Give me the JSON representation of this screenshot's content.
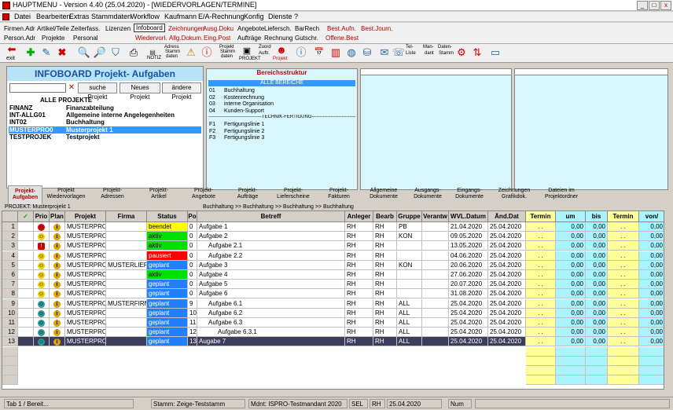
{
  "window": {
    "title": "HAUPTMENU - Version 4.40 (25.04.2020) - [WIEDERVORLAGEN/TERMINE]",
    "min": "_",
    "max": "□",
    "close": "x"
  },
  "menu": [
    "Datei",
    "Bearbeiten",
    "Extras",
    "Stammdaten",
    "Workflow",
    "Kaufmann",
    "E/A-Rechnung",
    "Konfig",
    "Dienste",
    "?"
  ],
  "quick_top": [
    "Firmen.Adr",
    "Artikel/Teile",
    "Zeiterfass.",
    "Lizenzen",
    "Infoboard",
    "Zeichnungen",
    "Ausg.Doku",
    "Angebote",
    "Liefersch.",
    "BarRech",
    "Best.Aufn.",
    "Best.Journ."
  ],
  "quick_bottom": [
    "Person.Adr",
    "Projekte",
    "Personal",
    "Wiedervorl.",
    "Allg.Dokum.",
    "Eing.Post",
    "Aufträge",
    "Rechnung",
    "Gutschr.",
    "Offene.Best"
  ],
  "toolbar": {
    "exit": "exit",
    "notiz": "NOTIZ",
    "adress": "Adress",
    "stamm": "Stamm",
    "daten": "daten",
    "projekt_stamm1": "Projekt",
    "projekt_stamm2": "Stamm",
    "projekt_stamm3": "daten",
    "projekt": "PROJEKT",
    "zuord1": "Zuord",
    "zuord2": "Auftr.",
    "projekt2": "Projekt",
    "tel1": "Tel-",
    "tel2": "Liste",
    "man1": "Man-",
    "man2": "dant",
    "ds1": "Daten-",
    "ds2": "Stamm"
  },
  "infoboard": {
    "title": "INFOBOARD  Projekt- Aufgaben",
    "clear": "✕",
    "btn_search": "suche Projekt",
    "btn_new": "Neues Projekt",
    "btn_change": "ändere Projekt",
    "all": "ALLE PROJEKTE",
    "projects": [
      {
        "code": "FINANZ",
        "name": "Finanzabteilung"
      },
      {
        "code": "INT-ALLG01",
        "name": "Allgemeine interne Angelegenheiten"
      },
      {
        "code": "INT02",
        "name": "Buchhaltung"
      },
      {
        "code": "MUSTERPRO0",
        "name": "Musterprojekt 1"
      },
      {
        "code": "TESTPROJEK",
        "name": "Testprojekt"
      }
    ]
  },
  "bereich": {
    "title": "Bereichsstruktur",
    "all": "ALLE BEREICHE",
    "items": [
      {
        "k": "01",
        "v": "Buchhaltung"
      },
      {
        "k": "02",
        "v": "Kostenrechnung"
      },
      {
        "k": "03",
        "v": "interne Organisation"
      },
      {
        "k": "04",
        "v": "Kunden-Support"
      }
    ],
    "sep": "----------------------------------TECHNIK-FERTIGUNG----------------------------------",
    "items2": [
      {
        "k": "F1",
        "v": "Fertigungslinie 1"
      },
      {
        "k": "F2",
        "v": "Fertigungslinie 2"
      },
      {
        "k": "F3",
        "v": "Fertigungslinie 3"
      }
    ]
  },
  "tabs": [
    [
      "Projekt-",
      "Aufgaben"
    ],
    [
      "Projekt",
      "Wiedervorlagen"
    ],
    [
      "Projekt-",
      "Adressen"
    ],
    [
      "Projekt-",
      "Artikel"
    ],
    [
      "Projekt-",
      "Angebote"
    ],
    [
      "Projekt-",
      "Aufträge"
    ],
    [
      "Projekt-",
      "Lieferscheine"
    ],
    [
      "Projekt-",
      "Fakturen"
    ],
    [
      "Allgemeine",
      "Dokumente"
    ],
    [
      "Ausgangs-",
      "Dokumente"
    ],
    [
      "Eingangs-",
      "Dokumente"
    ],
    [
      "Zeichnungen",
      "Grafikdok."
    ],
    [
      "Dateien im",
      "Projektordner"
    ]
  ],
  "breadcrumb": "Buchhaltung >> Buchhaltung >> Buchhaltung >> Buchhaltung",
  "projekt_label": "PROJEKT: Musterprojekt 1",
  "grid": {
    "headers": [
      "✓",
      "Prio",
      "Plan",
      "Projekt",
      "Firma",
      "Status",
      "Po",
      "Betreff",
      "Anleger",
      "Bearb",
      "Gruppe",
      "Verantw",
      "WVL.Datum",
      "Änd.Dat",
      "Termin",
      "um",
      "bis",
      "Termin",
      "von/"
    ],
    "rows": [
      {
        "n": "1",
        "prio": "",
        "firma": "",
        "status": "beendet",
        "po": "0",
        "betreff": "Aufgabe 1",
        "ind": 0,
        "bearb": "RH",
        "gruppe": "PB",
        "wvl": "21.04.2020",
        "aend": "25.04.2020",
        "face": "#d00"
      },
      {
        "n": "2",
        "prio": "",
        "firma": "",
        "status": "aktiv",
        "po": "0",
        "betreff": "Aufgabe 2",
        "ind": 0,
        "bearb": "RH",
        "gruppe": "KON",
        "wvl": "09.05.2020",
        "aend": "25.04.2020",
        "face": "#e8d000"
      },
      {
        "n": "3",
        "prio": "!",
        "firma": "",
        "status": "aktiv",
        "po": "0",
        "betreff": "Aufgabe 2.1",
        "ind": 1,
        "bearb": "RH",
        "gruppe": "",
        "wvl": "13.05.2020",
        "aend": "25.04.2020",
        "face": "#e8d000"
      },
      {
        "n": "4",
        "prio": "",
        "firma": "",
        "status": "pausiert",
        "po": "0",
        "betreff": "Aufgabe 2.2",
        "ind": 1,
        "bearb": "RH",
        "gruppe": "",
        "wvl": "04.06.2020",
        "aend": "25.04.2020",
        "face": "#e8d000"
      },
      {
        "n": "5",
        "prio": "",
        "firma": "MUSTERLIEFE",
        "status": "geplant",
        "po": "0",
        "betreff": "Aufgabe 3",
        "ind": 0,
        "bearb": "RH",
        "gruppe": "KON",
        "wvl": "20.06.2020",
        "aend": "25.04.2020",
        "face": "#e8d000"
      },
      {
        "n": "6",
        "prio": "",
        "firma": "",
        "status": "aktiv",
        "po": "0",
        "betreff": "Aufgabe 4",
        "ind": 0,
        "bearb": "RH",
        "gruppe": "",
        "wvl": "27.06.2020",
        "aend": "25.04.2020",
        "face": "#e8d000"
      },
      {
        "n": "7",
        "prio": "",
        "firma": "",
        "status": "geplant",
        "po": "0",
        "betreff": "Aufgabe 5",
        "ind": 0,
        "bearb": "RH",
        "gruppe": "",
        "wvl": "20.07.2020",
        "aend": "25.04.2020",
        "face": "#e8d000"
      },
      {
        "n": "8",
        "prio": "",
        "firma": "",
        "status": "geplant",
        "po": "0",
        "betreff": "Aufgabe 6",
        "ind": 0,
        "bearb": "RH",
        "gruppe": "",
        "wvl": "31.08.2020",
        "aend": "25.04.2020",
        "face": "#e8d000"
      },
      {
        "n": "9",
        "prio": "",
        "firma": "MUSTERFIRM",
        "status": "geplant",
        "po": "9",
        "betreff": "Aufgabe 6.1",
        "ind": 1,
        "bearb": "RH",
        "gruppe": "ALL",
        "wvl": "25.04.2020",
        "aend": "25.04.2020",
        "face": "#2a9a9a"
      },
      {
        "n": "10",
        "prio": "",
        "firma": "",
        "status": "geplant",
        "po": "10",
        "betreff": "Aufgabe 6.2",
        "ind": 1,
        "bearb": "RH",
        "gruppe": "ALL",
        "wvl": "25.04.2020",
        "aend": "25.04.2020",
        "face": "#2a9a9a"
      },
      {
        "n": "11",
        "prio": "",
        "firma": "",
        "status": "geplant",
        "po": "11",
        "betreff": "Aufgabe 6.3",
        "ind": 1,
        "bearb": "RH",
        "gruppe": "ALL",
        "wvl": "25.04.2020",
        "aend": "25.04.2020",
        "face": "#2a9a9a"
      },
      {
        "n": "12",
        "prio": "",
        "firma": "",
        "status": "geplant",
        "po": "12",
        "betreff": "Aufgabe 6.3.1",
        "ind": 2,
        "bearb": "RH",
        "gruppe": "ALL",
        "wvl": "25.04.2020",
        "aend": "25.04.2020",
        "face": "#2a9a9a"
      },
      {
        "n": "13",
        "prio": "",
        "firma": "",
        "status": "geplant",
        "po": "13",
        "betreff": "Augabe 7",
        "ind": 0,
        "bearb": "RH",
        "gruppe": "ALL",
        "wvl": "25.04.2020",
        "aend": "25.04.2020",
        "face": "#2a9a9a",
        "sel": true
      }
    ],
    "projekt": "MUSTERPRO(",
    "anleger": "RH",
    "termin": ". .",
    "zero": "0,00",
    "info": "i"
  },
  "statusbar": {
    "tab": "Tab 1 / Bereit...",
    "stamm": "Stamm: Zeige-Teststamm",
    "mdnt": "Mdnt: ISPRO-Testmandant 2020",
    "sel": "SEL",
    "user": "RH",
    "date": "25.04.2020",
    "num": "Num"
  },
  "colors": {
    "beendet": "#ffff00",
    "aktiv": "#00e000",
    "pausiert": "#ff0000",
    "geplant": "#2080ff",
    "selection": "#3399ff"
  }
}
